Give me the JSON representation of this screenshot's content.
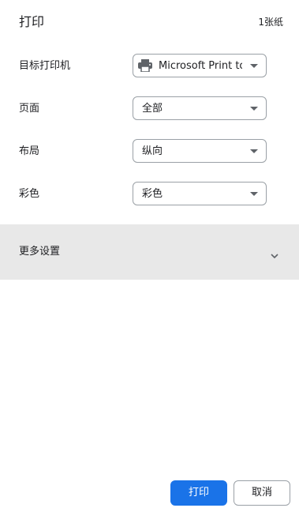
{
  "header": {
    "title": "打印",
    "sheet_count": "1张纸"
  },
  "settings": {
    "destination": {
      "label": "目标打印机",
      "value": "Microsoft Print to PDF",
      "icon": "printer-icon"
    },
    "pages": {
      "label": "页面",
      "value": "全部"
    },
    "layout": {
      "label": "布局",
      "value": "纵向"
    },
    "color": {
      "label": "彩色",
      "value": "彩色"
    }
  },
  "more_settings": {
    "label": "更多设置",
    "icon": "chevron-down-icon"
  },
  "buttons": {
    "print": "打印",
    "cancel": "取消"
  },
  "colors": {
    "accent": "#1a73e8",
    "more_settings_bg": "#e8e8e8",
    "border": "#9aa0a6"
  }
}
